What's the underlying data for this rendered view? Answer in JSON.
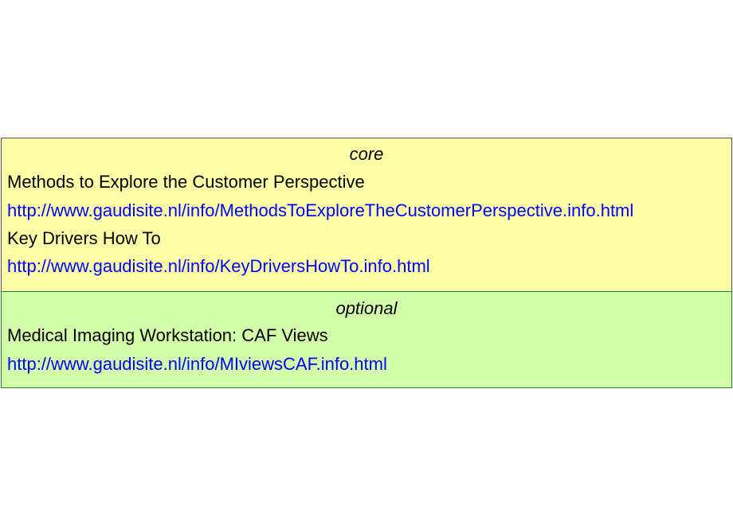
{
  "sections": [
    {
      "heading": "core",
      "entries": [
        {
          "title": "Methods to Explore the Customer Perspective",
          "url": "http://www.gaudisite.nl/info/MethodsToExploreTheCustomerPerspective.info.html"
        },
        {
          "title": "Key Drivers How To",
          "url": "http://www.gaudisite.nl/info/KeyDriversHowTo.info.html"
        }
      ],
      "color": "#ffffa8"
    },
    {
      "heading": "optional",
      "entries": [
        {
          "title": "Medical Imaging Workstation: CAF Views",
          "url": "http://www.gaudisite.nl/info/MIviewsCAF.info.html"
        }
      ],
      "color": "#d4ffaa"
    }
  ],
  "colors": {
    "link": "#0000ff",
    "text": "#000000"
  }
}
